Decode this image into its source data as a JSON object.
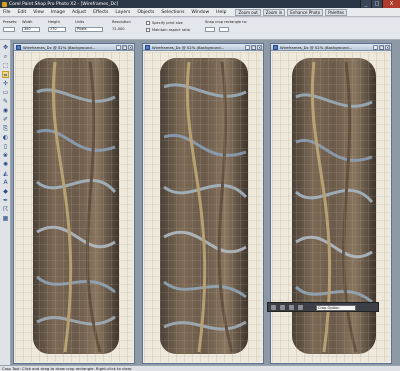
{
  "window": {
    "title": "Corel Paint Shop Pro Photo X2 - [Wireframes_Dc]",
    "minimize": "_",
    "maximize": "□",
    "close": "X"
  },
  "menu": {
    "items": [
      "File",
      "Edit",
      "View",
      "Image",
      "Adjust",
      "Effects",
      "Layers",
      "Objects",
      "Selections",
      "Window",
      "Help"
    ],
    "zoom_out_label": "Zoom out",
    "zoom_in_label": "Zoom in",
    "enhance_photo_label": "Enhance Photo",
    "palettes_label": "Palettes"
  },
  "options": {
    "presets_label": "Presets:",
    "width_label": "Width",
    "height_label": "Height",
    "units_label": "Units",
    "width_value": "300",
    "height_value": "270",
    "units_value": "Pixels",
    "resolution_label": "Resolution",
    "resolution_value": "72.000",
    "specify_print_size_label": "Specify print size",
    "maintain_aspect_label": "Maintain aspect ratio",
    "snap_label": "Snap crop rectangle to:"
  },
  "documents": [
    {
      "title": "Wireframes_Dc @ 52% (Background..."
    },
    {
      "title": "Wireframes_Dc @ 52% (Background..."
    },
    {
      "title": "Wireframes_Dc @ 52% (Background..."
    }
  ],
  "overview": {
    "crop_select_value": "Crop Option"
  },
  "status": {
    "text": "Crop Tool: Click and drag to draw crop rectangle. Right-click to clear."
  },
  "colors": {
    "titlebar": "#2b3646",
    "workspace": "#8e99a6",
    "canvas": "#efe9dc"
  }
}
